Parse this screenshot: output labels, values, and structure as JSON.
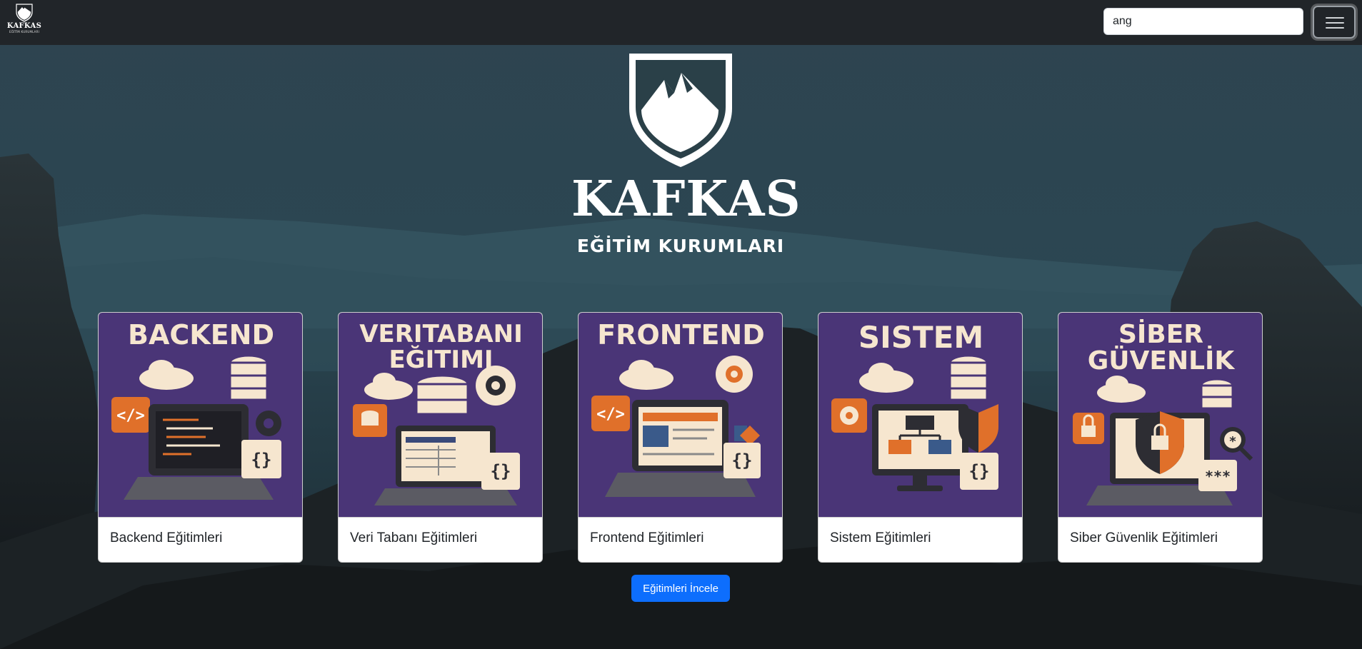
{
  "navbar": {
    "logo_text": "KAFKAS",
    "logo_subtext": "EĞİTİM KURUMLARI",
    "search": {
      "value": "ang",
      "placeholder": ""
    },
    "menu_icon": "hamburger-icon"
  },
  "hero": {
    "title": "KAFKAS",
    "subtitle": "EĞİTİM KURUMLARI",
    "logo_icon": "mountain-shield-icon"
  },
  "cards": [
    {
      "image_title_lines": [
        "BACKEND"
      ],
      "label": "Backend Eğitimleri",
      "icon": "backend-illustration"
    },
    {
      "image_title_lines": [
        "VERITABANI",
        "EĞITIMI"
      ],
      "label": "Veri Tabanı Eğitimleri",
      "icon": "database-illustration"
    },
    {
      "image_title_lines": [
        "FRONTEND"
      ],
      "label": "Frontend Eğitimleri",
      "icon": "frontend-illustration"
    },
    {
      "image_title_lines": [
        "SISTEM"
      ],
      "label": "Sistem Eğitimleri",
      "icon": "system-illustration"
    },
    {
      "image_title_lines": [
        "SİBER",
        "GÜVENLİK"
      ],
      "label": "Siber Güvenlik Eğitimleri",
      "icon": "security-illustration"
    }
  ],
  "cta": {
    "label": "Eğitimleri İncele"
  },
  "colors": {
    "navbar": "#212529",
    "card_image_bg": "#4a3577",
    "accent_orange": "#e0702a",
    "cream": "#f6e6cf",
    "primary_button": "#0d6efd"
  }
}
